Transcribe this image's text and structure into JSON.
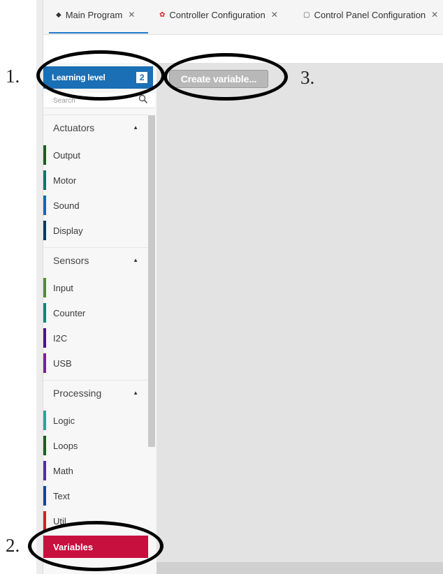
{
  "tabs": [
    {
      "label": "Main Program",
      "icon": "program-icon",
      "active": true
    },
    {
      "label": "Controller Configuration",
      "icon": "gear-icon",
      "active": false
    },
    {
      "label": "Control Panel Configuration",
      "icon": "document-icon",
      "active": false
    }
  ],
  "sidebar": {
    "learning_level": {
      "label": "Learning level",
      "value": "2"
    },
    "search": {
      "placeholder": "Search"
    },
    "categories": [
      {
        "title": "Actuators",
        "items": [
          {
            "label": "Output",
            "color": "#1b5e20"
          },
          {
            "label": "Motor",
            "color": "#00796b"
          },
          {
            "label": "Sound",
            "color": "#1565c0"
          },
          {
            "label": "Display",
            "color": "#0d3a5c"
          }
        ]
      },
      {
        "title": "Sensors",
        "items": [
          {
            "label": "Input",
            "color": "#558b2f"
          },
          {
            "label": "Counter",
            "color": "#00897b"
          },
          {
            "label": "I2C",
            "color": "#4a148c"
          },
          {
            "label": "USB",
            "color": "#7b1fa2"
          }
        ]
      },
      {
        "title": "Processing",
        "items": [
          {
            "label": "Logic",
            "color": "#26a69a"
          },
          {
            "label": "Loops",
            "color": "#1b5e20"
          },
          {
            "label": "Math",
            "color": "#512da8"
          },
          {
            "label": "Text",
            "color": "#0d47a1"
          },
          {
            "label": "Util",
            "color": "#c62828"
          },
          {
            "label": "Variables",
            "color": "#c8103f",
            "selected": true
          }
        ]
      }
    ]
  },
  "workspace": {
    "create_variable_label": "Create variable..."
  },
  "annotations": [
    {
      "number": "1."
    },
    {
      "number": "2."
    },
    {
      "number": "3."
    }
  ],
  "colors": {
    "accent": "#1a6fb5",
    "selected": "#c8103f",
    "workspace": "#e3e3e3"
  }
}
